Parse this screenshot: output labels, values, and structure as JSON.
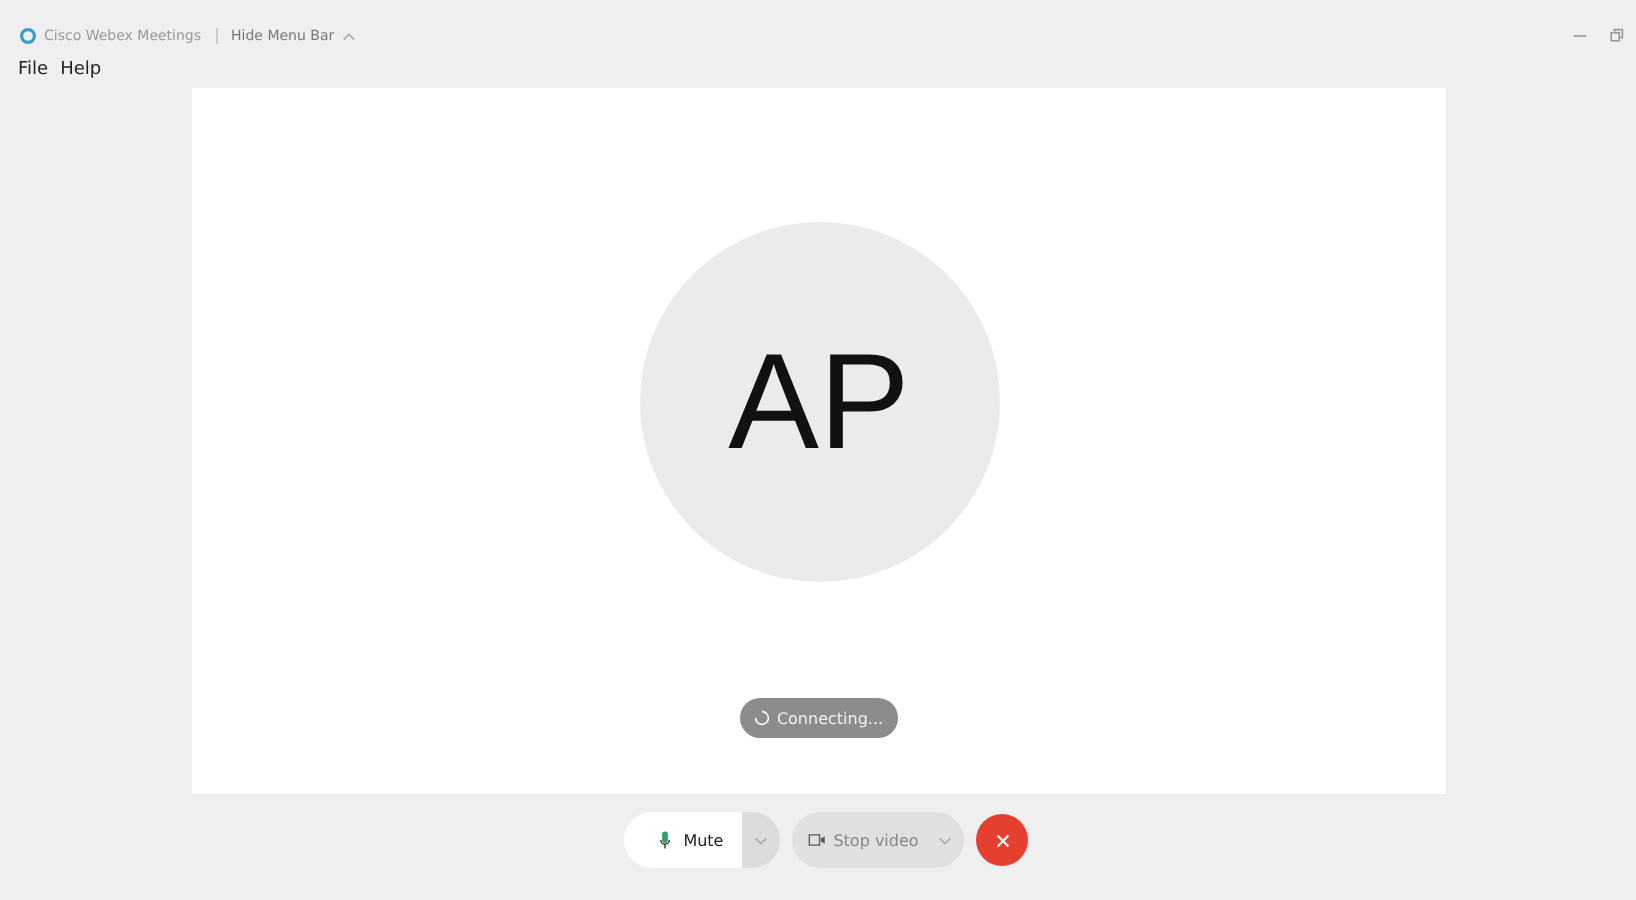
{
  "window": {
    "title": "Cisco Webex Meetings",
    "menu_toggle": "Hide Menu Bar"
  },
  "menu": [
    "File",
    "Help"
  ],
  "stage": {
    "initials": "AP",
    "status": "Connecting..."
  },
  "controls": [
    {
      "kind": "mute",
      "label": "Mute"
    },
    {
      "kind": "video",
      "label": "Stop video"
    },
    {
      "kind": "end"
    }
  ]
}
